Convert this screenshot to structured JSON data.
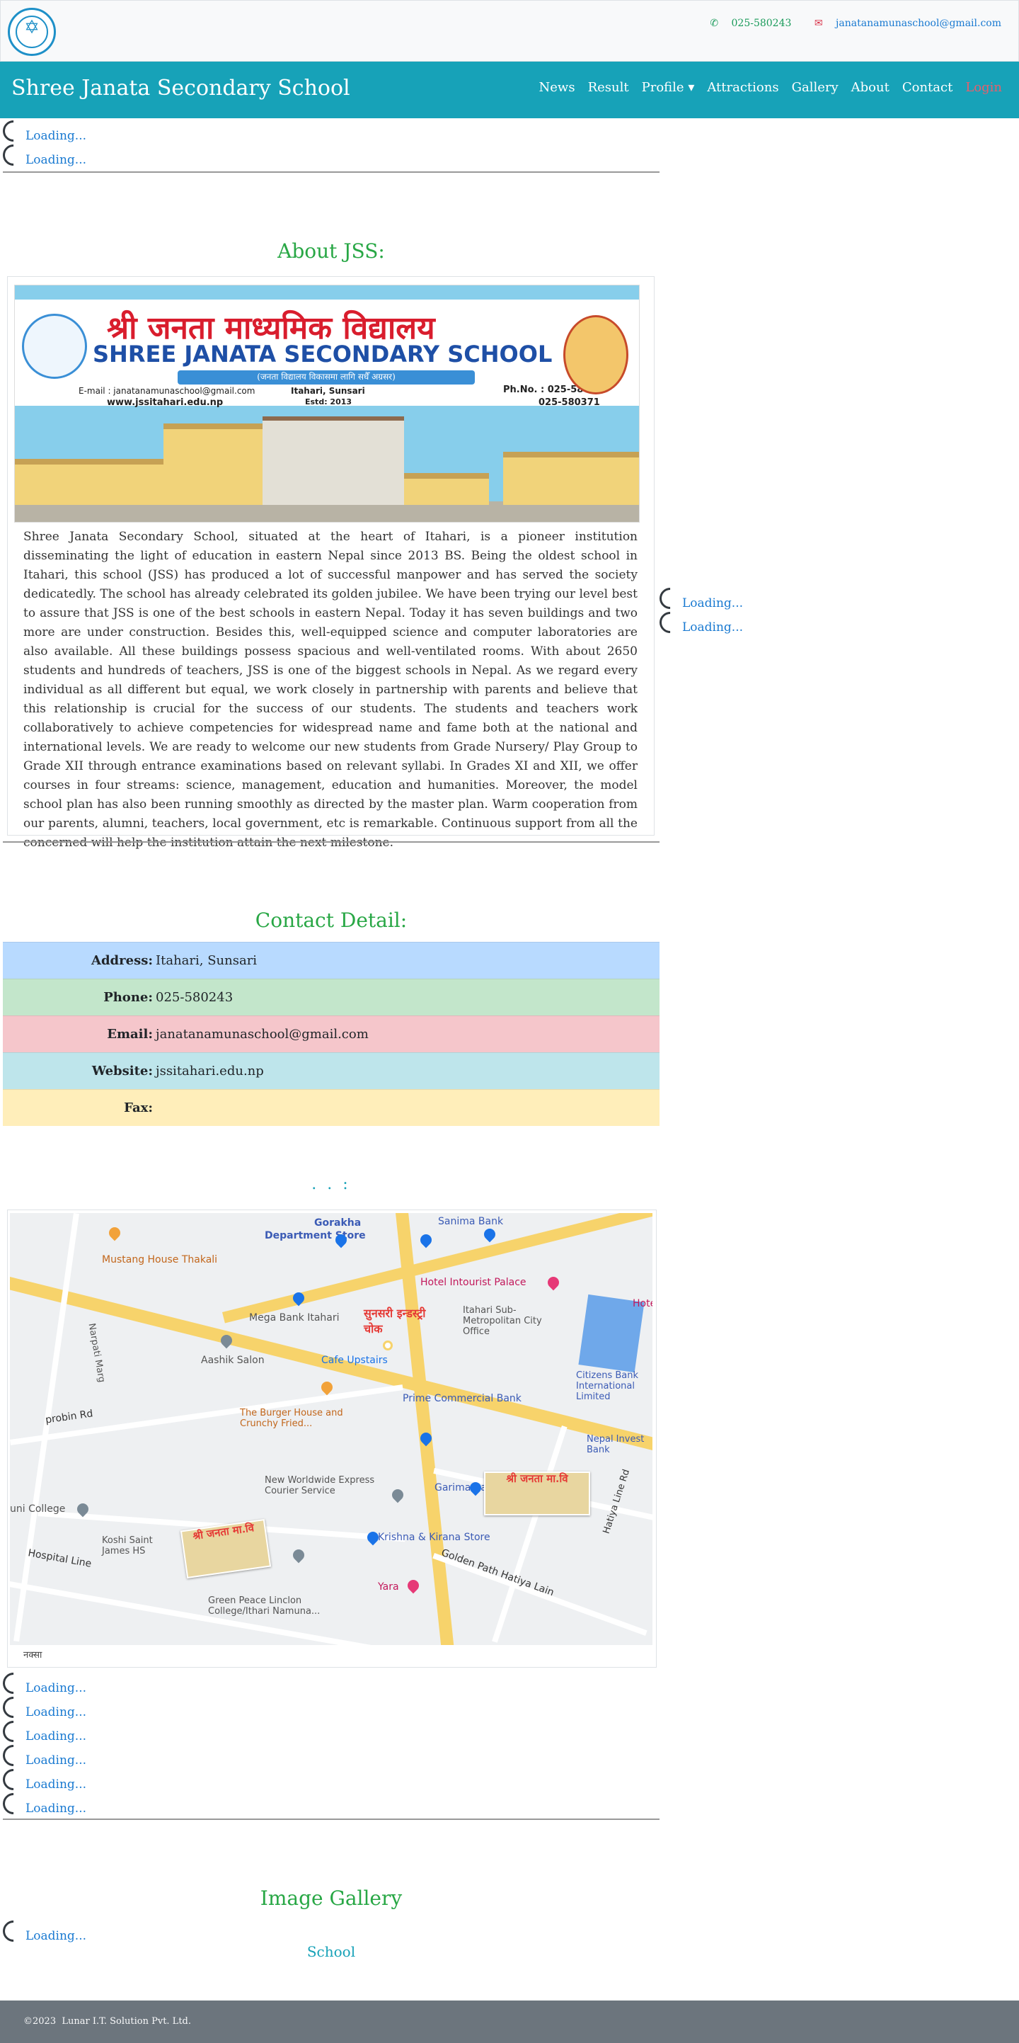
{
  "header": {
    "phone": "025-580243",
    "email": "janatanamunaschool@gmail.com"
  },
  "navbar": {
    "brand": "Shree Janata Secondary School",
    "items": [
      "News",
      "Result",
      "Profile",
      "Attractions",
      "Gallery",
      "About",
      "Contact"
    ],
    "login": "Login"
  },
  "loading_text": "Loading...",
  "about": {
    "title": "About JSS:",
    "banner": {
      "nepali_name": "श्री जनता माध्यमिक विद्यालय",
      "english_name": "SHREE JANATA SECONDARY SCHOOL",
      "tagline": "(जनता विद्यालय विकासमा लागि सधैँ अग्रसर)",
      "email": "E-mail : janatanamunaschool@gmail.com",
      "website": "www.jssitahari.edu.np",
      "location": "Itahari, Sunsari",
      "estd": "Estd: 2013",
      "phone1": "Ph.No. : 025-580243",
      "phone2": "025-580371"
    },
    "text": "Shree Janata Secondary School, situated at the heart of Itahari, is a pioneer institution disseminating the light of education in eastern Nepal since 2013 BS. Being the oldest school in Itahari, this school (JSS) has produced a lot of successful manpower and has served the society dedicatedly. The school has already celebrated its golden jubilee. We have been trying our level best to assure that JSS is one of the best schools in eastern Nepal. Today it has seven buildings and two more are under construction. Besides this, well-equipped science and computer laboratories are also available. All these buildings possess spacious and well-ventilated rooms. With about 2650 students and hundreds of teachers, JSS is one of the biggest schools in Nepal. As we regard every individual as all different but equal, we work closely in partnership with parents and believe that this relationship is crucial for the success of our students. The students and teachers work collaboratively to achieve competencies for widespread name and fame both at the national and international levels. We are ready to welcome our new students from Grade Nursery/ Play Group to Grade XII through entrance examinations based on relevant syllabi. In Grades XI and XII, we offer courses in four streams: science, management, education and humanities. Moreover, the model school plan has also been running smoothly as directed by the master plan. Warm cooperation from our parents, alumni, teachers, local government, etc is remarkable. Continuous support from all the concerned will help the institution attain the next milestone."
  },
  "contact": {
    "title": "Contact Detail:",
    "rows": [
      {
        "label": "Address:",
        "value": "Itahari, Sunsari"
      },
      {
        "label": "Phone:",
        "value": "025-580243"
      },
      {
        "label": "Email:",
        "value": "janatanamunaschool@gmail.com"
      },
      {
        "label": "Website:",
        "value": "jssitahari.edu.np"
      },
      {
        "label": "Fax:",
        "value": ""
      }
    ]
  },
  "map": {
    "title": ". . :",
    "caption": "नक्सा",
    "labels": {
      "gorkha": "Gorakha",
      "dept": "Department Store",
      "sanima": "Sanima Bank",
      "mustang": "Mustang House Thakali",
      "hotel": "Hotel Intourist Palace",
      "hot": "Hote",
      "mega": "Mega Bank Itahari",
      "itahari_city": "Itahari Sub-Metropolitan City Office",
      "aashik": "Aashik Salon",
      "cafe": "Cafe Upstairs",
      "citizens": "Citizens Bank International Limited",
      "prime": "Prime Commercial Bank",
      "probin": "probin Rd",
      "narpati": "Narpati Marg",
      "burger": "The Burger House and Crunchy Fried...",
      "nepal_invest": "Nepal Invest Bank",
      "new_world": "New Worldwide Express Courier Service",
      "garima": "Garima Bank",
      "uni_college": "uni College",
      "koshi": "Koshi Saint James HS",
      "krishna": "Krishna & Kirana Store",
      "hospital": "Hospital Line",
      "golden": "Golden Path Hatiya Lain",
      "hatiya": "Hatiya Line Rd",
      "green": "Green Peace Linclon College/Ithari Namuna...",
      "yara": "Yara",
      "chowk": "सुनसरी इन्डस्ट्री चोक",
      "school1": "श्री जनता मा.वि",
      "school2": "श्री जनता मा.वि"
    }
  },
  "gallery": {
    "title": "Image Gallery",
    "link": "School"
  },
  "footer": {
    "year": "©2023",
    "company": "Lunar I.T. Solution Pvt. Ltd."
  },
  "colors": {
    "navbar": "#17a2b8",
    "section_title": "#28a745",
    "link": "#1a7ad1",
    "footer": "#6c757d"
  }
}
